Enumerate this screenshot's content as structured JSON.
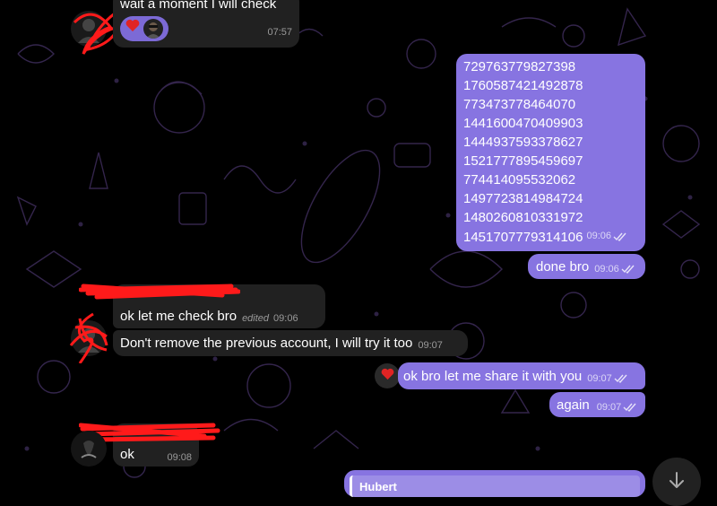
{
  "colors": {
    "background": "#000000",
    "incoming_bubble": "#212121",
    "outgoing_bubble": "#8774e1",
    "scribble_red": "#ff1a1a",
    "reaction_heart": "#e02424",
    "pattern": "#3a2a55"
  },
  "messages": {
    "m1": {
      "text": "wait a moment  I will check",
      "time": "07:57",
      "reaction": "heart"
    },
    "m2": {
      "lines": [
        "729763779827398",
        "1760587421492878",
        "773473778464070",
        "1441600470409903",
        "1444937593378627",
        "1521777895459697",
        "774414095532062",
        "1497723814984724",
        "1480260810331972",
        "1451707779314106"
      ],
      "time": "09:06"
    },
    "m3": {
      "text": "done bro",
      "time": "09:06"
    },
    "m4": {
      "text": "ok  let me  check bro",
      "edited": "edited",
      "time": "09:06"
    },
    "m5": {
      "text": "Don't remove the previous account, I will try it too",
      "time": "09:07"
    },
    "m6": {
      "text": "ok bro let me share it with you",
      "time": "09:07",
      "reaction": "heart"
    },
    "m7": {
      "text": "again",
      "time": "09:07"
    },
    "m8": {
      "text": "ok",
      "time": "09:08"
    },
    "m9": {
      "text": "Hubert"
    }
  },
  "scroll_button": {
    "icon": "arrow-down-icon"
  }
}
